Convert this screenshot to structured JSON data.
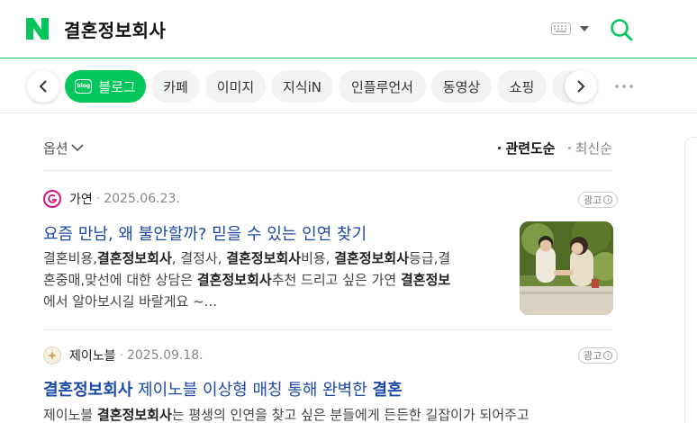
{
  "header": {
    "query": "결혼정보회사",
    "brand_color": "#03c75a",
    "logo_icon": "naver-logo",
    "keyboard_icon": "keyboard-icon",
    "search_icon": "search-icon"
  },
  "tabs": [
    {
      "label": "블로그",
      "active": true,
      "badge": "blog"
    },
    {
      "label": "카페"
    },
    {
      "label": "이미지"
    },
    {
      "label": "지식iN"
    },
    {
      "label": "인플루언서"
    },
    {
      "label": "동영상"
    },
    {
      "label": "쇼핑"
    },
    {
      "label": "뉴"
    }
  ],
  "options_label": "옵션",
  "sort": [
    {
      "label": "관련도순",
      "active": true
    },
    {
      "label": "최신순",
      "active": false
    }
  ],
  "results": [
    {
      "source": "가연",
      "date": "2025.06.23.",
      "ad_label": "광고",
      "title": [
        {
          "t": "요즘 만남, 왜 불안할까? 믿을 수 있는 인연 찾기"
        }
      ],
      "desc_lines": [
        [
          {
            "t": "결혼비용,"
          },
          {
            "t": "결혼정보회사",
            "b": true
          },
          {
            "t": ", 결정사, "
          },
          {
            "t": "결혼정보회사",
            "b": true
          },
          {
            "t": "비용, "
          },
          {
            "t": "결혼정보회사",
            "b": true
          },
          {
            "t": "등급,결"
          }
        ],
        [
          {
            "t": "혼중매,맞선에 대한 상담은 "
          },
          {
            "t": "결혼정보회사",
            "b": true
          },
          {
            "t": "추천 드리고 싶은 가연 "
          },
          {
            "t": "결혼정보",
            "b": true
          }
        ],
        [
          {
            "t": "에서 알아보시길 바랄게요 ~..."
          }
        ]
      ],
      "thumbnail": "couple-photo"
    },
    {
      "source": "제이노블",
      "date": "2025.09.18.",
      "ad_label": "광고",
      "title": [
        {
          "t": "결혼정보회사",
          "b": true
        },
        {
          "t": " 제이노블 이상형 매칭 통해 완벽한 "
        },
        {
          "t": "결혼",
          "b": true
        }
      ],
      "desc_lines": [
        [
          {
            "t": "제이노블 "
          },
          {
            "t": "결혼정보회사",
            "b": true
          },
          {
            "t": "는 평생의 인연을 찾고 싶은 분들에게 든든한 길잡이가 되어주고"
          }
        ]
      ]
    }
  ]
}
